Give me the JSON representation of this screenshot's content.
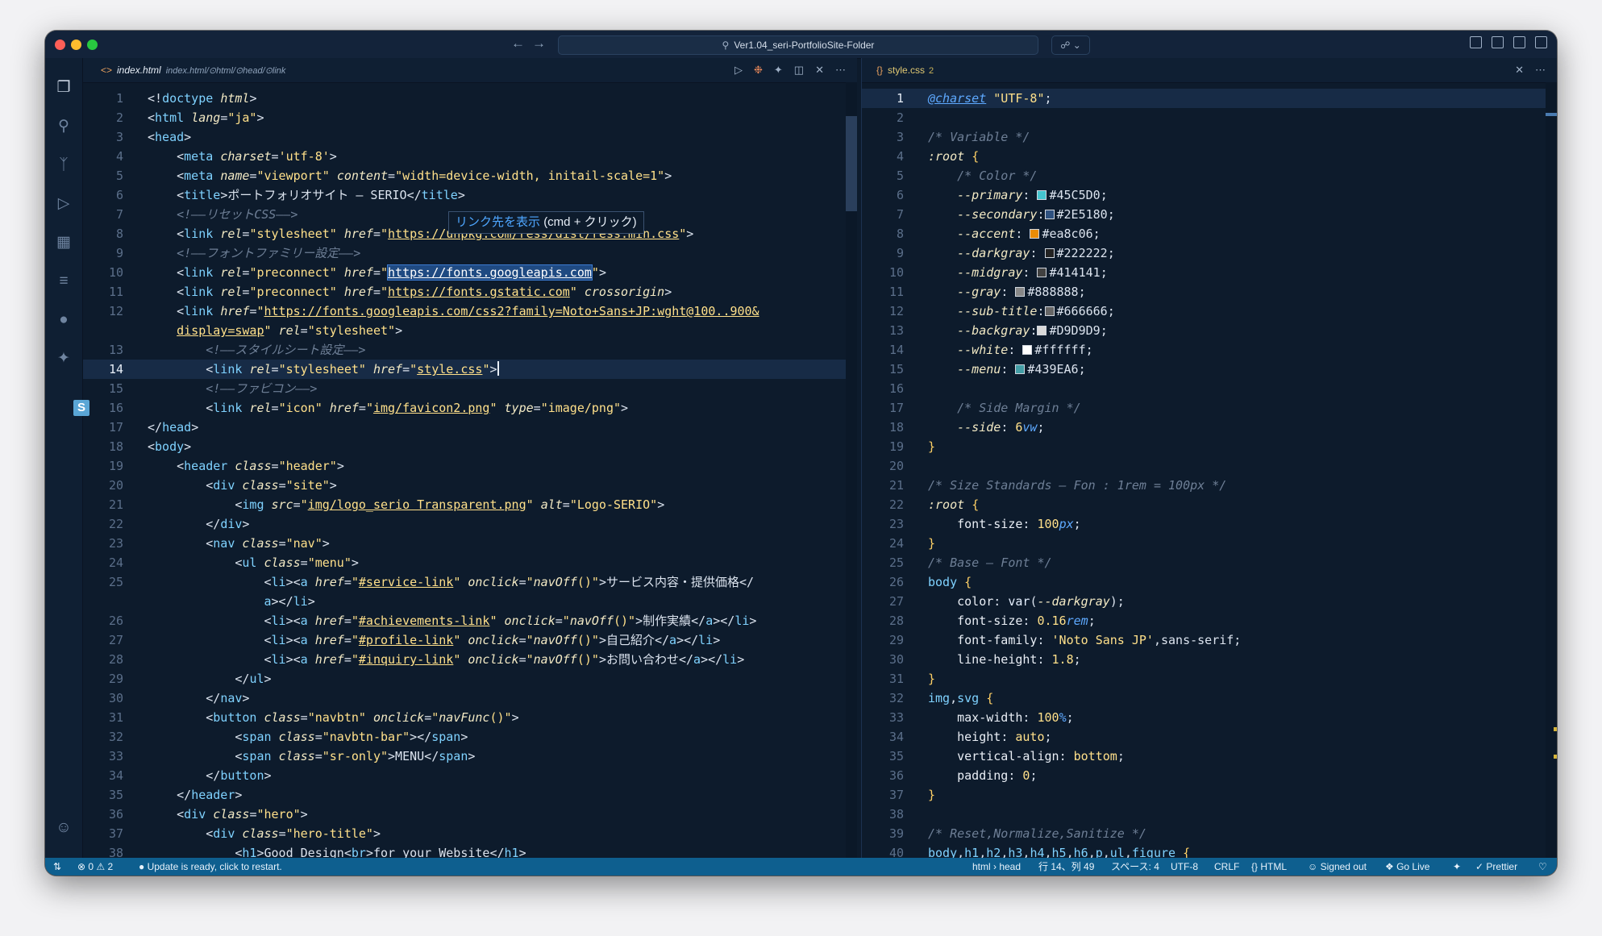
{
  "titlebar": {
    "search_text": "Ver1.04_seri-PortfolioSite-Folder",
    "back_icon": "arrow-left-icon",
    "forward_icon": "arrow-right-icon"
  },
  "left_editor": {
    "tab": {
      "filename": "index.html",
      "breadcrumb": "index.html/⊙html/⊙head/⊙link"
    },
    "tooltip": {
      "text": "リンク先を表示",
      "shortcut": "(cmd + クリック)"
    },
    "line_numbers": [
      "1",
      "2",
      "3",
      "4",
      "5",
      "6",
      "7",
      "8",
      "9",
      "10",
      "11",
      "12",
      "",
      "13",
      "14",
      "15",
      "16",
      "17",
      "18",
      "19",
      "20",
      "21",
      "22",
      "23",
      "24",
      "25",
      "",
      "26",
      "27",
      "28",
      "29",
      "30",
      "31",
      "32",
      "33",
      "34",
      "35",
      "36",
      "37",
      "38"
    ]
  },
  "right_editor": {
    "tab": {
      "filename": "style.css",
      "problems": "2"
    },
    "line_numbers": [
      "1",
      "2",
      "3",
      "4",
      "5",
      "6",
      "7",
      "8",
      "9",
      "10",
      "11",
      "12",
      "13",
      "14",
      "15",
      "16",
      "17",
      "18",
      "19",
      "20",
      "21",
      "22",
      "23",
      "24",
      "25",
      "26",
      "27",
      "28",
      "29",
      "30",
      "31",
      "32",
      "33",
      "34",
      "35",
      "36",
      "37",
      "38",
      "39",
      "40"
    ],
    "colors": {
      "primary": "#45C5D0",
      "secondary": "#2E5180",
      "accent": "#ea8c06",
      "darkgray": "#222222",
      "midgray": "#414141",
      "gray": "#888888",
      "sub_title": "#666666",
      "backgray": "#D9D9D9",
      "white": "#ffffff",
      "menu": "#439EA6"
    }
  },
  "statusbar": {
    "errors": "0",
    "warnings": "2",
    "update_msg": "Update is ready, click to restart.",
    "breadcrumb": "html › head",
    "position": "行 14、列 49",
    "spaces": "スペース: 4",
    "encoding": "UTF-8",
    "eol": "CRLF",
    "language": "HTML",
    "account": "Signed out",
    "golive": "Go Live",
    "prettier": "Prettier"
  }
}
